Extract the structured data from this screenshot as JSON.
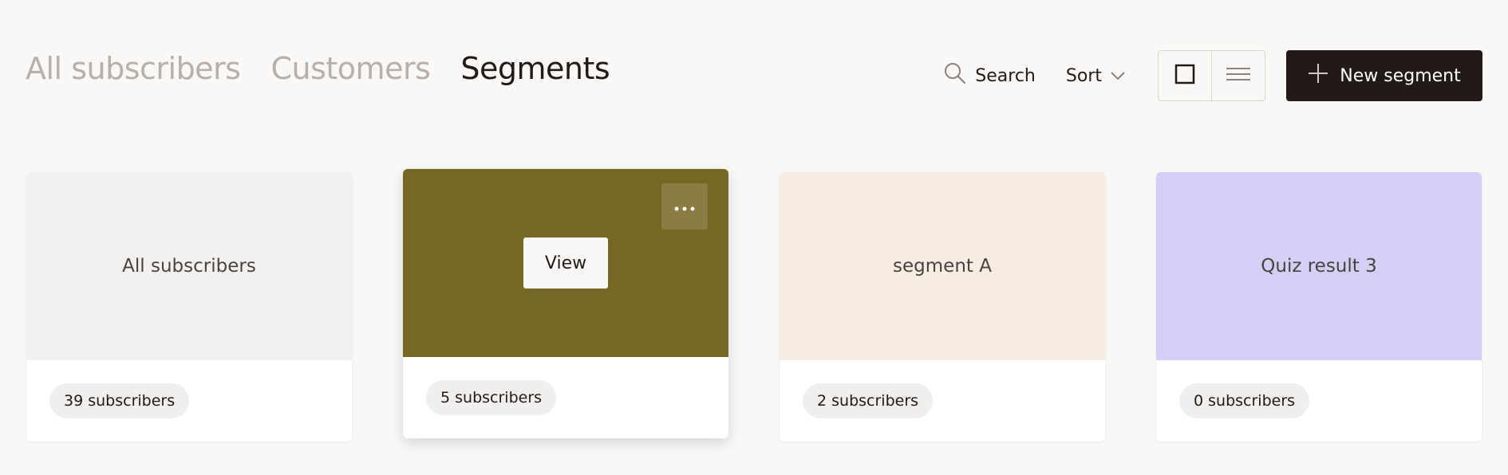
{
  "tabs": [
    {
      "label": "All subscribers",
      "active": false
    },
    {
      "label": "Customers",
      "active": false
    },
    {
      "label": "Segments",
      "active": true
    }
  ],
  "toolbar": {
    "search_label": "Search",
    "search_icon": "search-icon",
    "sort_label": "Sort",
    "sort_icon": "chevron-down-icon",
    "grid_view_icon": "grid-view-icon",
    "list_view_icon": "list-view-icon",
    "new_segment_label": "New segment",
    "new_segment_icon": "plus-icon"
  },
  "cards": [
    {
      "title": "All subscribers",
      "count": "39 subscribers",
      "color": "#f2f1f0"
    },
    {
      "title": "",
      "count": "5 subscribers",
      "color": "#776724",
      "hover_action": "View",
      "more_icon": "more-horizontal-icon"
    },
    {
      "title": "segment A",
      "count": "2 subscribers",
      "color": "#f6ece2"
    },
    {
      "title": "Quiz result 3",
      "count": "0 subscribers",
      "color": "#d4cff5"
    }
  ],
  "colors": {
    "background": "#f9f8f6",
    "primary": "#221a18",
    "muted_tab": "#b5b0ac"
  }
}
